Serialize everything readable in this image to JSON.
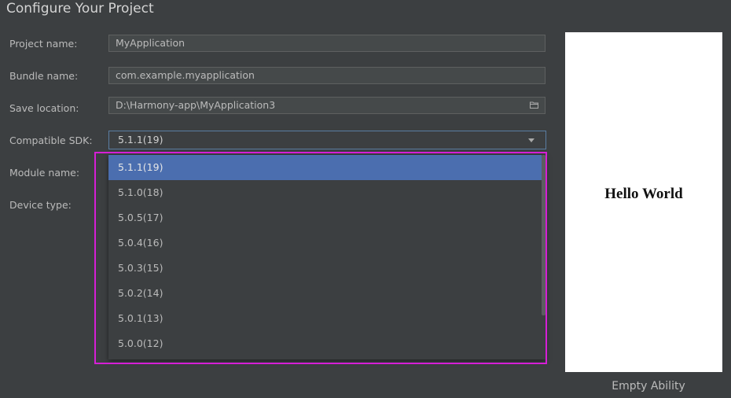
{
  "title": "Configure Your Project",
  "form": {
    "project_name": {
      "label": "Project name:",
      "value": "MyApplication"
    },
    "bundle_name": {
      "label": "Bundle name:",
      "value": "com.example.myapplication"
    },
    "save_location": {
      "label": "Save location:",
      "value": "D:\\Harmony-app\\MyApplication3",
      "icon": "folder-icon"
    },
    "compatible_sdk": {
      "label": "Compatible SDK:",
      "value": "5.1.1(19)",
      "icon": "chevron-down-icon"
    },
    "module_name": {
      "label": "Module name:"
    },
    "device_type": {
      "label": "Device type:"
    }
  },
  "sdk_dropdown": {
    "options": [
      "5.1.1(19)",
      "5.1.0(18)",
      "5.0.5(17)",
      "5.0.4(16)",
      "5.0.3(15)",
      "5.0.2(14)",
      "5.0.1(13)",
      "5.0.0(12)"
    ],
    "selected_index": 0
  },
  "preview": {
    "text": "Hello World",
    "template_name": "Empty Ability"
  },
  "colors": {
    "background": "#3c3f41",
    "selection": "#4b6eaf",
    "highlight_border": "#d61fd6",
    "preview_background": "#ffffff"
  }
}
